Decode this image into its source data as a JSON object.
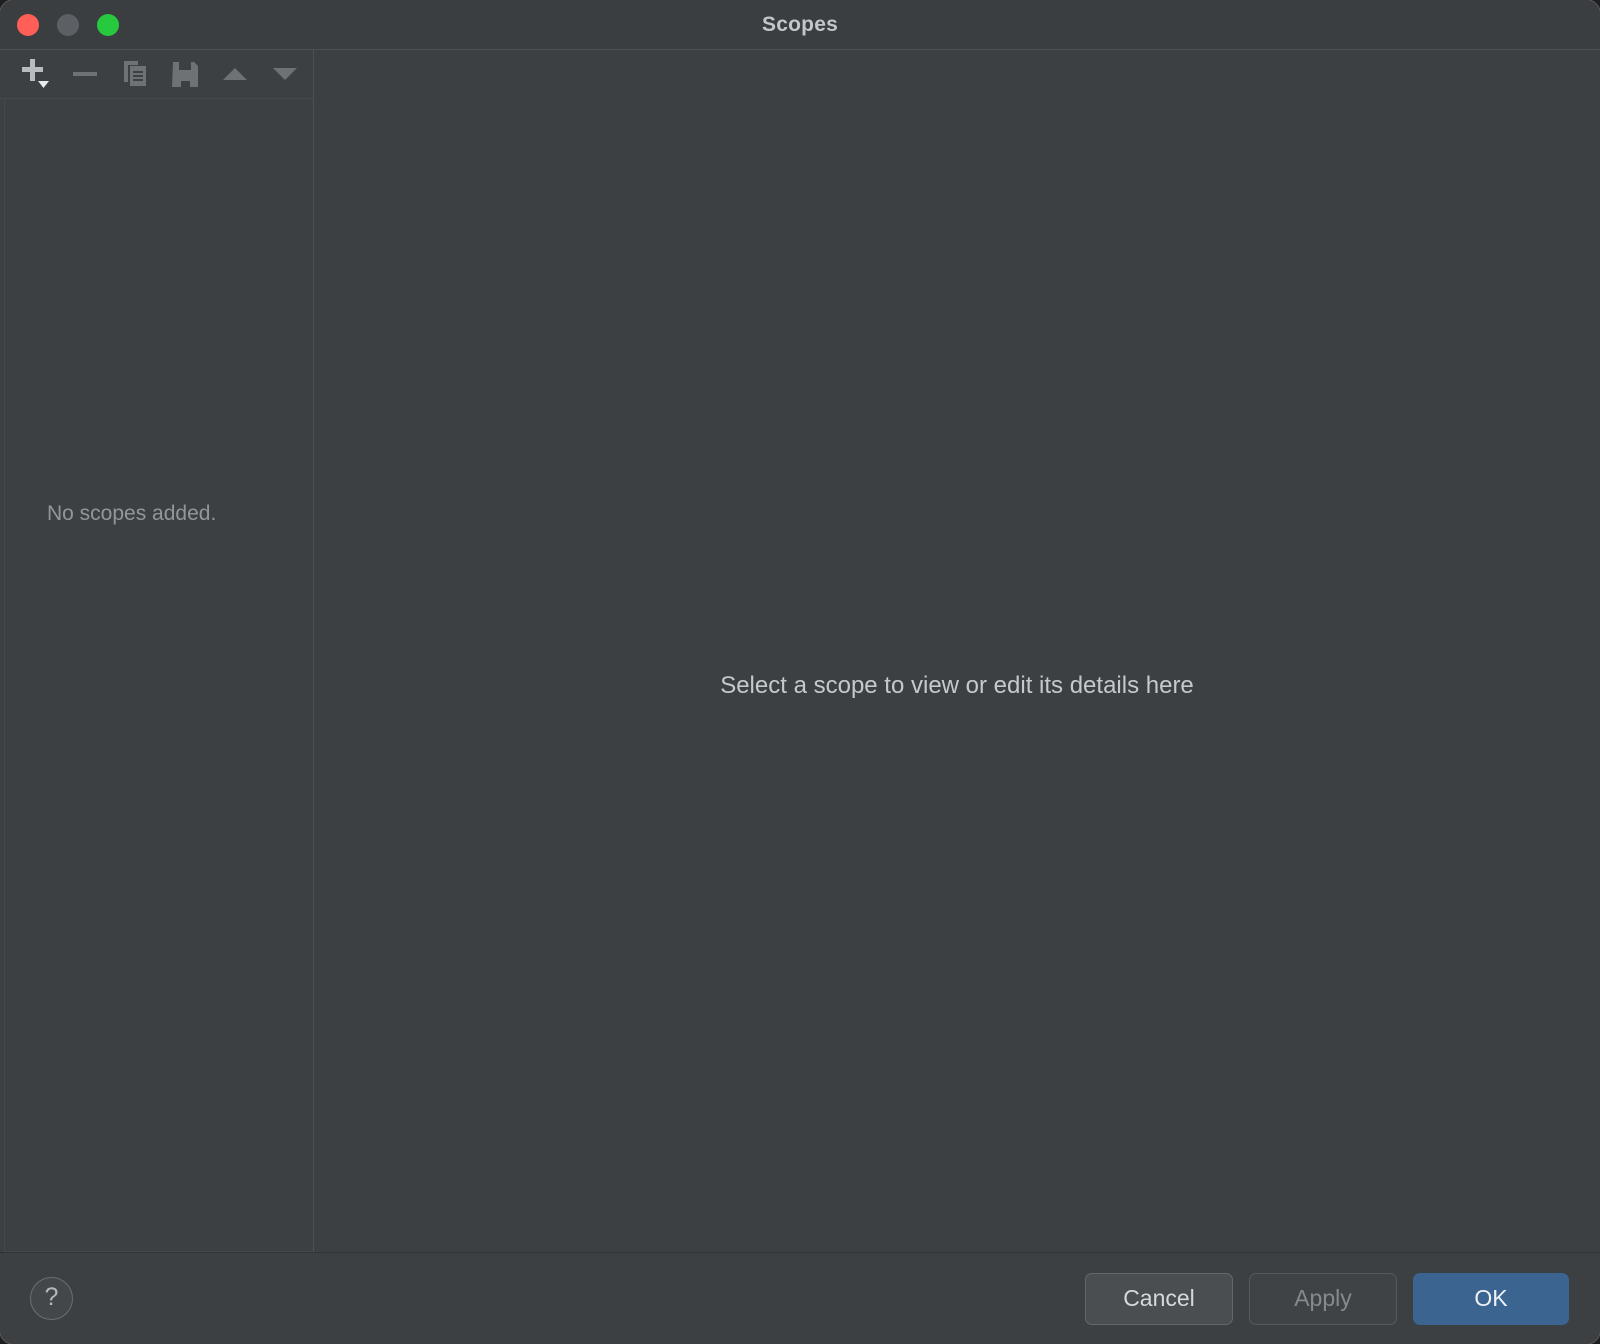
{
  "window": {
    "title": "Scopes",
    "traffic_lights": [
      {
        "name": "close",
        "color": "#ff5f56"
      },
      {
        "name": "minimize",
        "color": "#5c6065"
      },
      {
        "name": "maximize",
        "color": "#27c93f"
      }
    ]
  },
  "toolbar": {
    "buttons": [
      {
        "icon": "add-icon",
        "label": "Add",
        "enabled": true,
        "has_dropdown": true
      },
      {
        "icon": "remove-icon",
        "label": "Remove",
        "enabled": false,
        "has_dropdown": false
      },
      {
        "icon": "copy-icon",
        "label": "Duplicate",
        "enabled": false,
        "has_dropdown": false
      },
      {
        "icon": "save-icon",
        "label": "Save",
        "enabled": false,
        "has_dropdown": false
      },
      {
        "icon": "move-up-icon",
        "label": "Move Up",
        "enabled": false,
        "has_dropdown": false
      },
      {
        "icon": "move-down-icon",
        "label": "Move Down",
        "enabled": false,
        "has_dropdown": false
      }
    ]
  },
  "scope_list": {
    "items": [],
    "empty_message": "No scopes added."
  },
  "details_pane": {
    "placeholder": "Select a scope to view or edit its details here"
  },
  "footer": {
    "help_label": "?",
    "cancel_label": "Cancel",
    "apply_label": "Apply",
    "ok_label": "OK"
  },
  "colors": {
    "window_bg": "#3c4043",
    "titlebar_bg": "#3a3e41",
    "divider": "#4d5154",
    "text_primary": "#c6c9cc",
    "text_muted": "#92969a",
    "accent_primary": "#3b6491"
  }
}
